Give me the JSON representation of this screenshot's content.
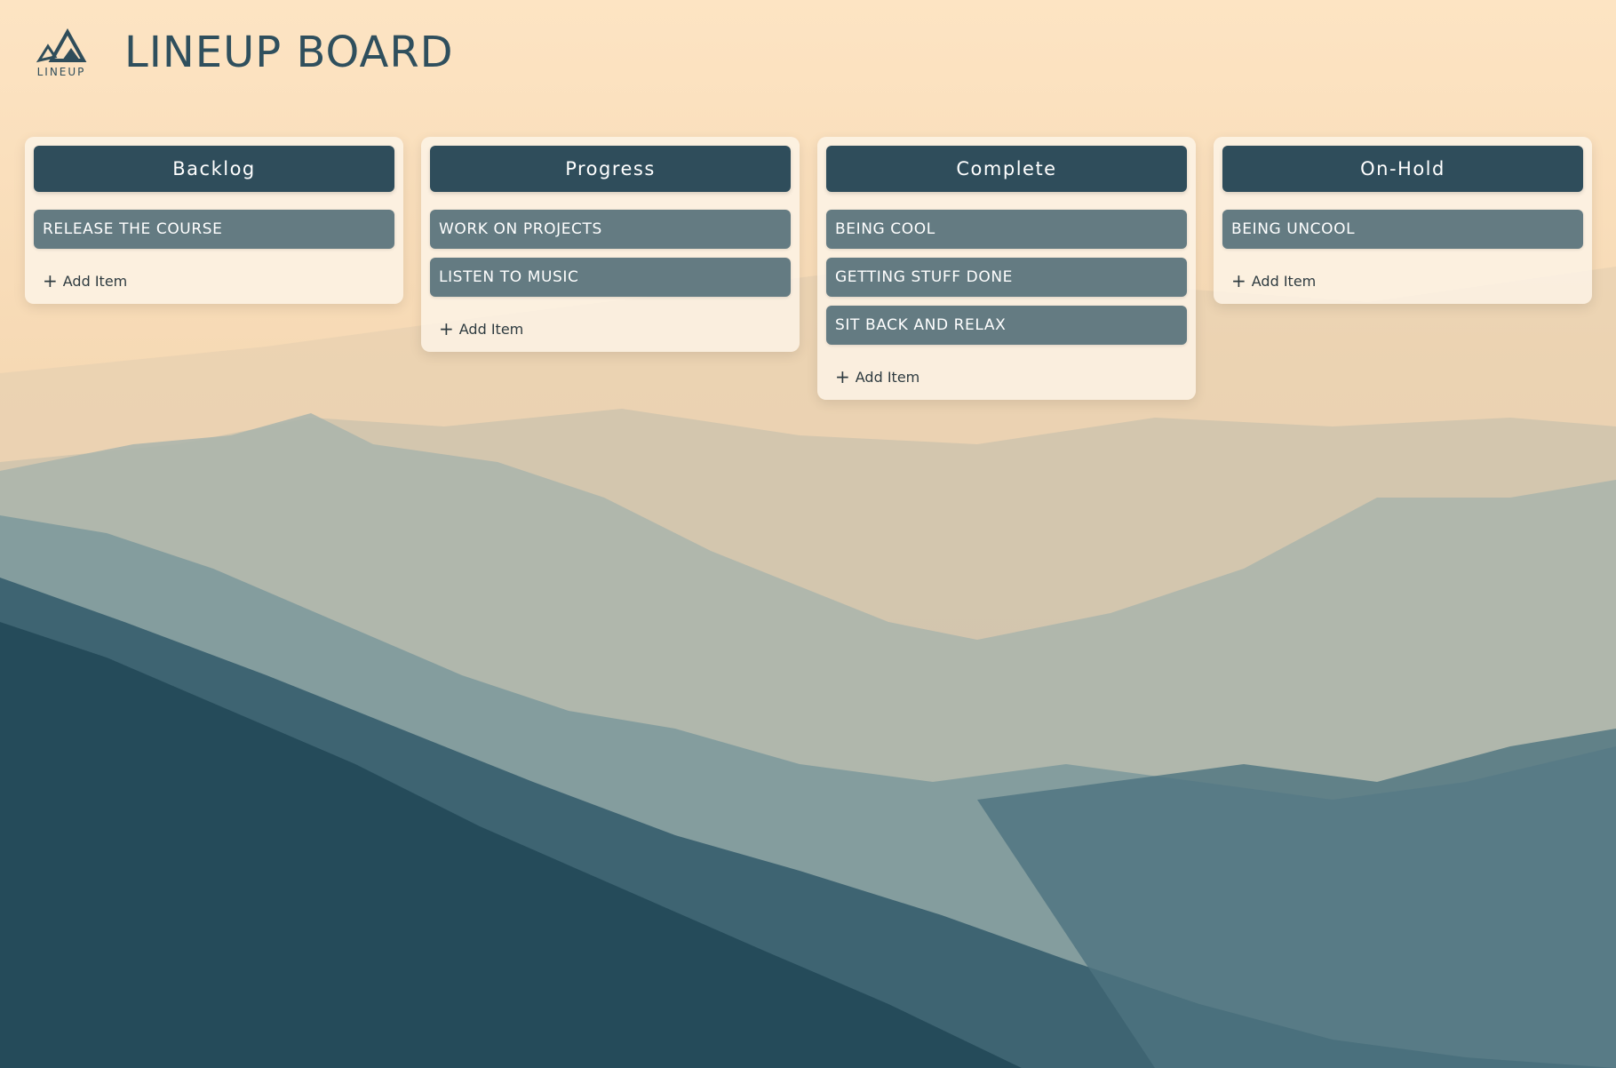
{
  "app": {
    "logo_text": "LINEUP",
    "title": "LINEUP BOARD"
  },
  "columns": [
    {
      "title": "Backlog",
      "items": [
        "RELEASE THE COURSE"
      ],
      "add_label": "Add Item"
    },
    {
      "title": "Progress",
      "items": [
        "WORK ON PROJECTS",
        "LISTEN TO MUSIC"
      ],
      "add_label": "Add Item"
    },
    {
      "title": "Complete",
      "items": [
        "BEING COOL",
        "GETTING STUFF DONE",
        "SIT BACK AND RELAX"
      ],
      "add_label": "Add Item"
    },
    {
      "title": "On-Hold",
      "items": [
        "BEING UNCOOL"
      ],
      "add_label": "Add Item"
    }
  ],
  "icons": {
    "add": "plus-icon",
    "logo": "mountain-logo-icon"
  },
  "colors": {
    "header_bg": "#2f4d5b",
    "item_bg": "#647b82",
    "title_text": "#2f4f5d"
  }
}
